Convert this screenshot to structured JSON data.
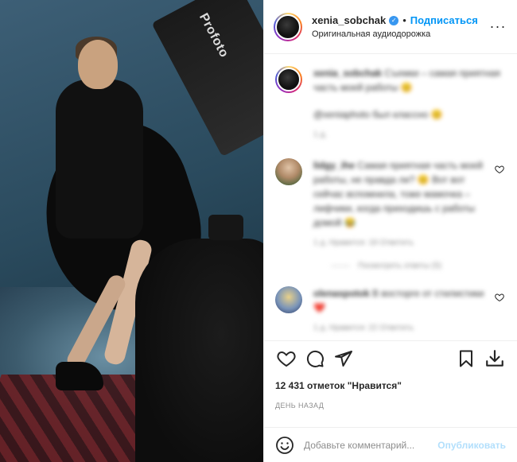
{
  "media": {
    "softbox_brand": "Profoto"
  },
  "header": {
    "username": "xenia_sobchak",
    "verified_icon": "verified-badge-icon",
    "separator": "•",
    "follow_label": "Подписаться",
    "audio_label": "Оригинальная аудиодорожка",
    "more_icon": "more-options-icon",
    "more_glyph": "···"
  },
  "comments": {
    "caption": {
      "username": "xenia_sobchak",
      "text": "Съемки – самая приятная часть моей работы 😊",
      "mention": "@xeniaphoto был классно 😊",
      "time": "1 д."
    },
    "items": [
      {
        "username": "lidgy_ihe",
        "text": "Самая приятная часть моей работы, не правда ли? 😊 Вот вот сейчас вспомнила, тоже мамочка – лифчики, когда приходишь с работы домой 😂",
        "meta": "1 д.    Нравится: 18    Ответить",
        "replies": "Посмотреть ответы (5)"
      },
      {
        "username": "olenaspotok",
        "text": "В восторге от стилистики ❤️",
        "meta": "1 д.    Нравится: 22    Ответить"
      }
    ]
  },
  "actions": {
    "like_icon": "heart-icon",
    "comment_icon": "comment-icon",
    "share_icon": "share-icon",
    "save_icon": "bookmark-icon",
    "download_icon": "download-icon"
  },
  "likes_text": "12 431 отметок \"Нравится\"",
  "time_text": "ДЕНЬ НАЗАД",
  "composer": {
    "emoji_icon": "emoji-icon",
    "placeholder": "Добавьте комментарий...",
    "publish_label": "Опубликовать"
  }
}
